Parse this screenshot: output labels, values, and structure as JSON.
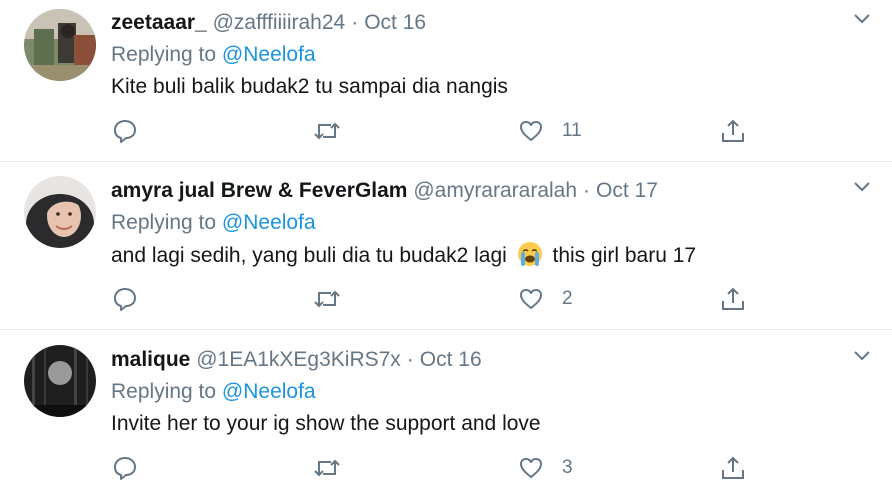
{
  "tweets": [
    {
      "name": "zeetaaar_",
      "handle": "@zafffiiiirah24",
      "date": "Oct 16",
      "replying_prefix": "Replying to",
      "replying_to": "@Neelofa",
      "text": "Kite buli balik budak2 tu sampai dia nangis",
      "text_after_emoji": "",
      "likes": "11",
      "avatar": "photo of person outdoors"
    },
    {
      "name": "amyra jual Brew & FeverGlam",
      "handle": "@amyrarararalah",
      "date": "Oct 17",
      "replying_prefix": "Replying to",
      "replying_to": "@Neelofa",
      "text": "and lagi sedih, yang buli dia tu budak2 lagi",
      "text_after_emoji": "this girl baru 17",
      "emoji": "loudly-crying-face",
      "likes": "2",
      "avatar": "woman wearing hijab"
    },
    {
      "name": "malique",
      "handle": "@1EA1kXEg3KiRS7x",
      "date": "Oct 16",
      "replying_prefix": "Replying to",
      "replying_to": "@Neelofa",
      "text": "Invite her to your ig show the support and love",
      "text_after_emoji": "",
      "likes": "3",
      "avatar": "dark forest with moon"
    }
  ],
  "colors": {
    "text": "#14171a",
    "secondary": "#657786",
    "link": "#1b95e0",
    "divider": "#e6ecf0"
  },
  "icons": [
    "reply-icon",
    "retweet-icon",
    "like-icon",
    "share-icon",
    "chevron-down-icon"
  ]
}
